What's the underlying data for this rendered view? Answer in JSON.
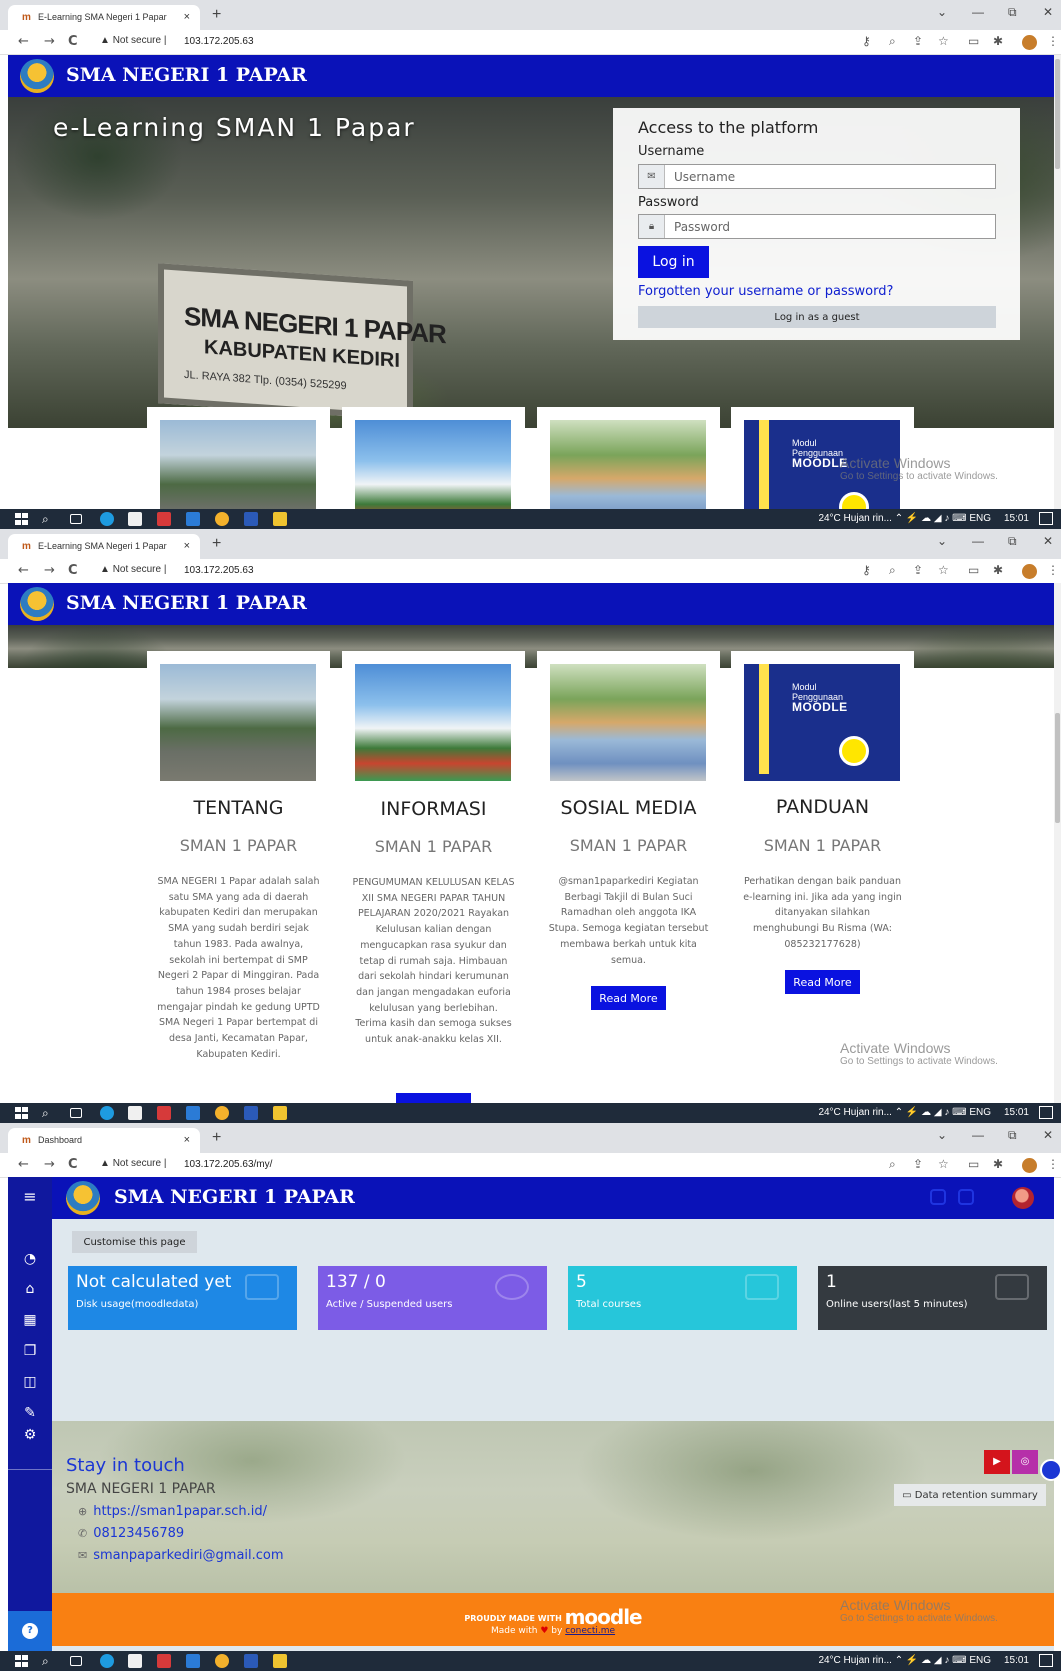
{
  "screens": [
    {
      "tab_title": "E-Learning SMA Negeri 1 Papar",
      "url": "103.172.205.63"
    },
    {
      "tab_title": "E-Learning SMA Negeri 1 Papar",
      "url": "103.172.205.63"
    },
    {
      "tab_title": "Dashboard",
      "url": "103.172.205.63/my/"
    }
  ],
  "browser": {
    "not_secure": "Not secure",
    "new_tab": "+",
    "back": "←",
    "forward": "→",
    "reload": "C",
    "tab_close": "×",
    "minimize": "—",
    "restore": "⧉",
    "close": "✕",
    "tab_list": "⌄"
  },
  "site": {
    "name": "SMA NEGERI 1 PAPAR"
  },
  "hero": {
    "title": "e-Learning SMAN 1 Papar",
    "gate_line1": "SMA NEGERI 1 PAPAR",
    "gate_line2": "KABUPATEN KEDIRI",
    "gate_line3": "JL. RAYA 382 Tlp. (0354) 525299"
  },
  "login": {
    "heading": "Access to the platform",
    "username_label": "Username",
    "username_placeholder": "Username",
    "password_label": "Password",
    "password_placeholder": "Password",
    "login_button": "Log in",
    "forgot_link": "Forgotten your username or password?",
    "guest_button": "Log in as a guest"
  },
  "cards": [
    {
      "title": "TENTANG",
      "subtitle": "SMAN 1 PAPAR",
      "text": "SMA NEGERI 1 Papar adalah salah satu SMA yang ada di daerah kabupaten Kediri dan merupakan SMA yang sudah berdiri sejak tahun 1983. Pada awalnya, sekolah ini bertempat di SMP Negeri 2 Papar di Minggiran. Pada tahun 1984 proses belajar mengajar pindah ke gedung UPTD SMA Negeri 1 Papar bertempat di desa Janti, Kecamatan Papar, Kabupaten Kediri."
    },
    {
      "title": "INFORMASI",
      "subtitle": "SMAN 1 PAPAR",
      "text": "PENGUMUMAN KELULUSAN KELAS XII SMA NEGERI PAPAR TAHUN PELAJARAN 2020/2021 Rayakan Kelulusan kalian dengan mengucapkan rasa syukur dan tetap di rumah saja. Himbauan dari sekolah hindari kerumunan dan jangan mengadakan euforia kelulusan yang berlebihan. Terima kasih dan semoga sukses untuk anak-anakku kelas XII."
    },
    {
      "title": "SOSIAL MEDIA",
      "subtitle": "SMAN 1 PAPAR",
      "text": "@sman1paparkediri Kegiatan Berbagi Takjil di Bulan Suci Ramadhan oleh anggota IKA Stupa. Semoga kegiatan tersebut membawa berkah untuk kita semua.",
      "button": "Read More"
    },
    {
      "title": "PANDUAN",
      "subtitle": "SMAN 1 PAPAR",
      "text": "Perhatikan dengan baik panduan e-learning ini. Jika ada yang ingin ditanyakan silahkan menghubungi Bu Risma (WA: 085232177628)",
      "button": "Read More",
      "image_text1": "Modul",
      "image_text2": "Penggunaan",
      "image_text3": "MOODLE"
    }
  ],
  "watermark": {
    "line1": "Activate Windows",
    "line2": "Go to Settings to activate Windows."
  },
  "taskbar": {
    "weather": "24°C  Hujan rin...",
    "lang": "ENG",
    "time": "15:01"
  },
  "dashboard": {
    "customise": "Customise this page",
    "stats": [
      {
        "value": "Not calculated yet",
        "label": "Disk usage(moodledata)",
        "color": "#1e88e5"
      },
      {
        "value": "137 / 0",
        "label": "Active / Suspended users",
        "color": "#7c5ce6"
      },
      {
        "value": "5",
        "label": "Total courses",
        "color": "#26c6da"
      },
      {
        "value": "1",
        "label": "Online users(last 5 minutes)",
        "color": "#343a40"
      }
    ],
    "stay_in_touch": "Stay in touch",
    "school_name": "SMA NEGERI 1 PAPAR",
    "website": "https://sman1papar.sch.id/",
    "phone": "08123456789",
    "email": "smanpaparkediri@gmail.com",
    "data_retention": "Data retention summary",
    "proudly_made": "PROUDLY MADE WITH",
    "moodle": "moodle",
    "made_with": "Made with",
    "by": "by",
    "author": "conecti.me"
  }
}
